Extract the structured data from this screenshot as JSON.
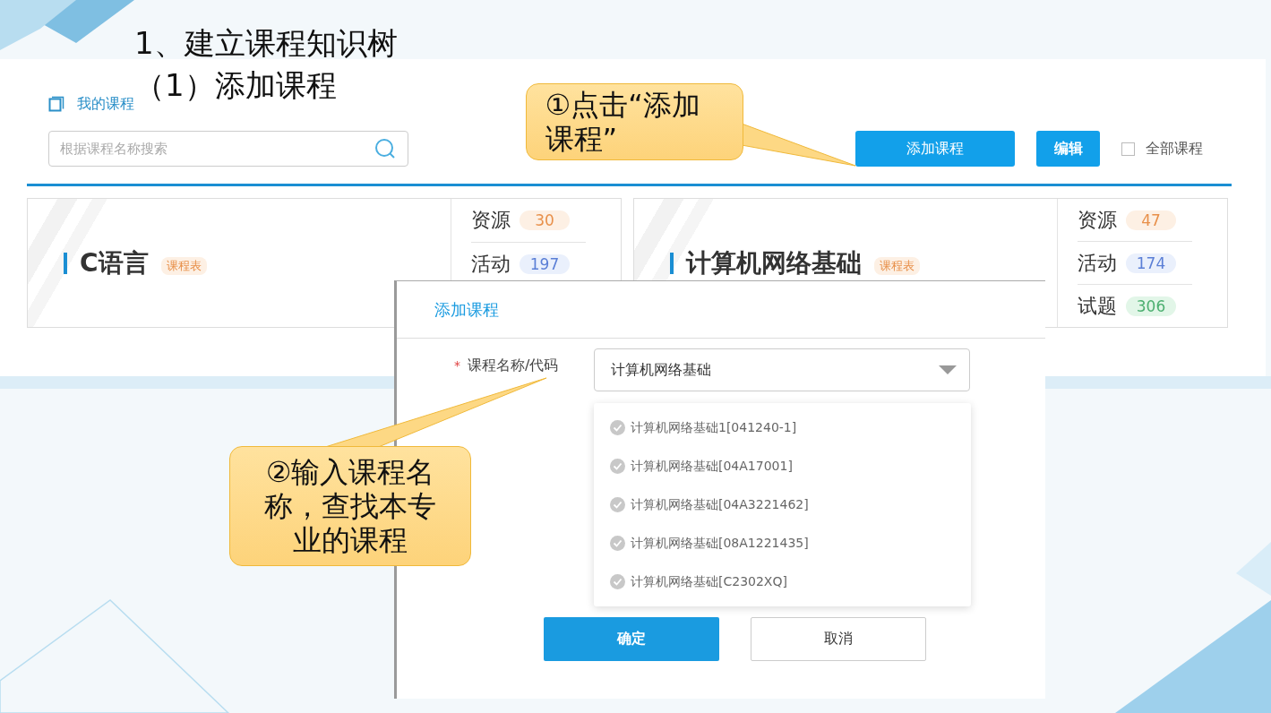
{
  "slide_title": "1、建立课程知识树",
  "slide_subtitle": "（1）添加课程",
  "page": {
    "breadcrumb": "我的课程",
    "search": {
      "placeholder": "根据课程名称搜索"
    },
    "add_button": "添加课程",
    "edit_button": "编辑",
    "all_courses": {
      "label": "全部课程",
      "checked": false
    }
  },
  "courses": [
    {
      "name": "C语言",
      "tag": "课程表",
      "stats": [
        {
          "kind": "resource",
          "label": "资源",
          "count": "30"
        },
        {
          "kind": "activity",
          "label": "活动",
          "count": "197"
        }
      ]
    },
    {
      "name": "计算机网络基础",
      "tag": "课程表",
      "stats": [
        {
          "kind": "resource",
          "label": "资源",
          "count": "47"
        },
        {
          "kind": "activity",
          "label": "活动",
          "count": "174"
        },
        {
          "kind": "quiz",
          "label": "试题",
          "count": "306"
        }
      ]
    }
  ],
  "dialog": {
    "title": "添加课程",
    "required_mark": "*",
    "field_label": "课程名称/代码",
    "field_value": "计算机网络基础",
    "options": [
      {
        "label": "计算机网络基础1[041240-1]",
        "selected": false
      },
      {
        "label": "计算机网络基础[04A17001]",
        "selected": false
      },
      {
        "label": "计算机网络基础[04A3221462]",
        "selected": false
      },
      {
        "label": "计算机网络基础[08A1221435]",
        "selected": false
      },
      {
        "label": "计算机网络基础[C2302XQ]",
        "selected": false
      }
    ],
    "confirm": "确定",
    "cancel": "取消"
  },
  "callouts": [
    {
      "text": "①点击“添加课程”"
    },
    {
      "text": "②输入课程名称，查找本专业的课程"
    }
  ]
}
